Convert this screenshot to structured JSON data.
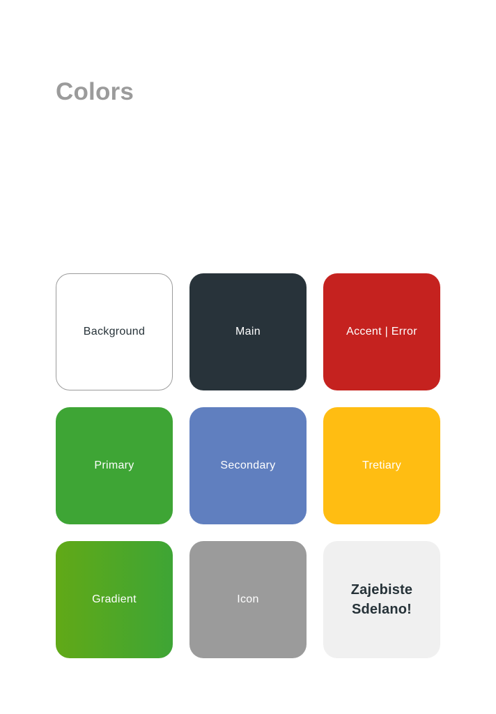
{
  "page": {
    "title": "Colors"
  },
  "swatches": [
    {
      "label": "Background",
      "color": "#ffffff",
      "text_color": "#263238",
      "outlined": true
    },
    {
      "label": "Main",
      "color": "#28333a",
      "text_color": "#ffffff"
    },
    {
      "label": "Accent | Error",
      "color": "#c5221f",
      "text_color": "#ffffff"
    },
    {
      "label": "Primary",
      "color": "#3ea535",
      "text_color": "#ffffff"
    },
    {
      "label": "Secondary",
      "color": "#607fbf",
      "text_color": "#ffffff"
    },
    {
      "label": "Tretiary",
      "color": "#ffbd12",
      "text_color": "#ffffff"
    },
    {
      "label": "Gradient",
      "gradient": [
        "#61a917",
        "#3ea535"
      ],
      "text_color": "#ffffff"
    },
    {
      "label": "Icon",
      "color": "#9b9b9b",
      "text_color": "#ffffff"
    },
    {
      "label": "Zajebiste\nSdelano!",
      "color": "#f0f0f0",
      "text_color": "#263238",
      "bold": true
    }
  ]
}
